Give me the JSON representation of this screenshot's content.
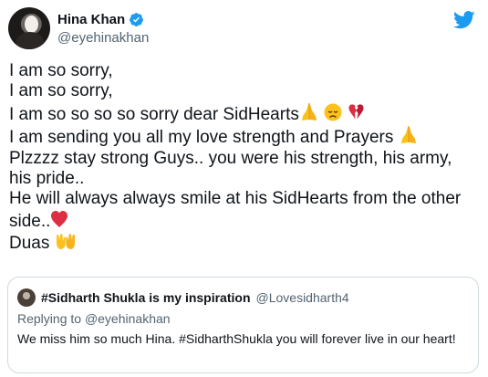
{
  "author": {
    "display_name": "Hina Khan",
    "handle": "@eyehinakhan",
    "verified": true
  },
  "tweet": {
    "lines": [
      "I am so sorry,",
      "I am so sorry,",
      "I am so so so so sorry dear SidHearts",
      "I am sending you all my love strength and Prayers",
      "Plzzzz stay strong Guys.. you were his strength, his army,",
      "his pride..",
      "He will always always smile at his SidHearts from the other",
      "side..",
      "Duas"
    ],
    "emoji": {
      "line3": [
        "folded-hands",
        "disappointed-face",
        "broken-heart"
      ],
      "line4": [
        "folded-hands"
      ],
      "line8": [
        "red-heart"
      ],
      "line9": [
        "open-hands"
      ]
    }
  },
  "quote": {
    "display_name": "#Sidharth Shukla is my inspiration",
    "handle": "@Lovesidharth4",
    "replying_prefix": "Replying to",
    "replying_to": "@eyehinakhan",
    "text": "We miss him so much Hina. #SidharthShukla you will forever live in our heart!"
  },
  "colors": {
    "twitter_blue": "#1d9bf0",
    "text": "#0f1419",
    "secondary": "#536471",
    "border": "#cfd9de"
  },
  "icons": {
    "verified": "verified-badge-icon",
    "logo": "twitter-bird-icon"
  }
}
